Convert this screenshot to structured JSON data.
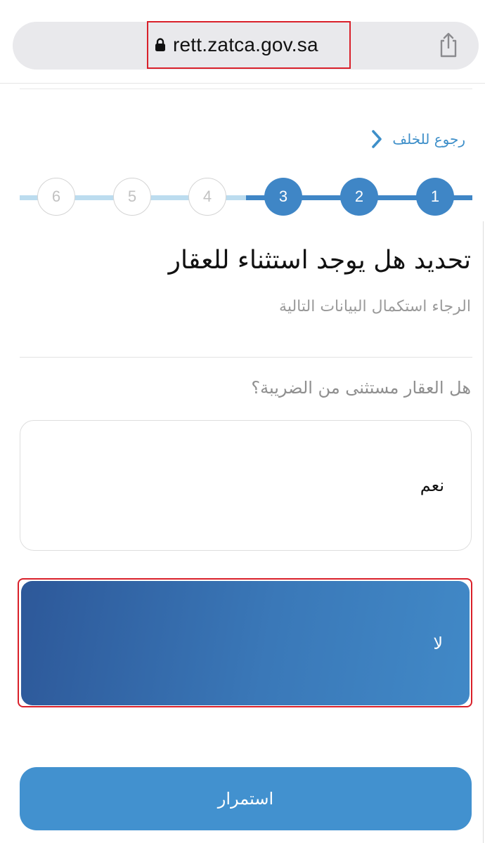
{
  "browser": {
    "url": "rett.zatca.gov.sa"
  },
  "back_link": {
    "label": "رجوع للخلف"
  },
  "stepper": {
    "current_step": 3,
    "steps": [
      "1",
      "2",
      "3",
      "4",
      "5",
      "6"
    ]
  },
  "form": {
    "title": "تحديد هل يوجد استثناء للعقار",
    "subtitle": "الرجاء استكمال البيانات التالية",
    "question": "هل العقار مستثنى من الضريبة؟",
    "options": {
      "yes": "نعم",
      "no": "لا"
    },
    "selected_option": "لا",
    "continue_label": "استمرار"
  },
  "colors": {
    "accent": "#3f86c6",
    "inactive_track": "#bcdcef",
    "highlight_border": "#d9202a",
    "button": "#4291cf"
  },
  "icons": {
    "lock": "lock-icon",
    "share": "share-icon",
    "back": "chevron-right-icon"
  }
}
